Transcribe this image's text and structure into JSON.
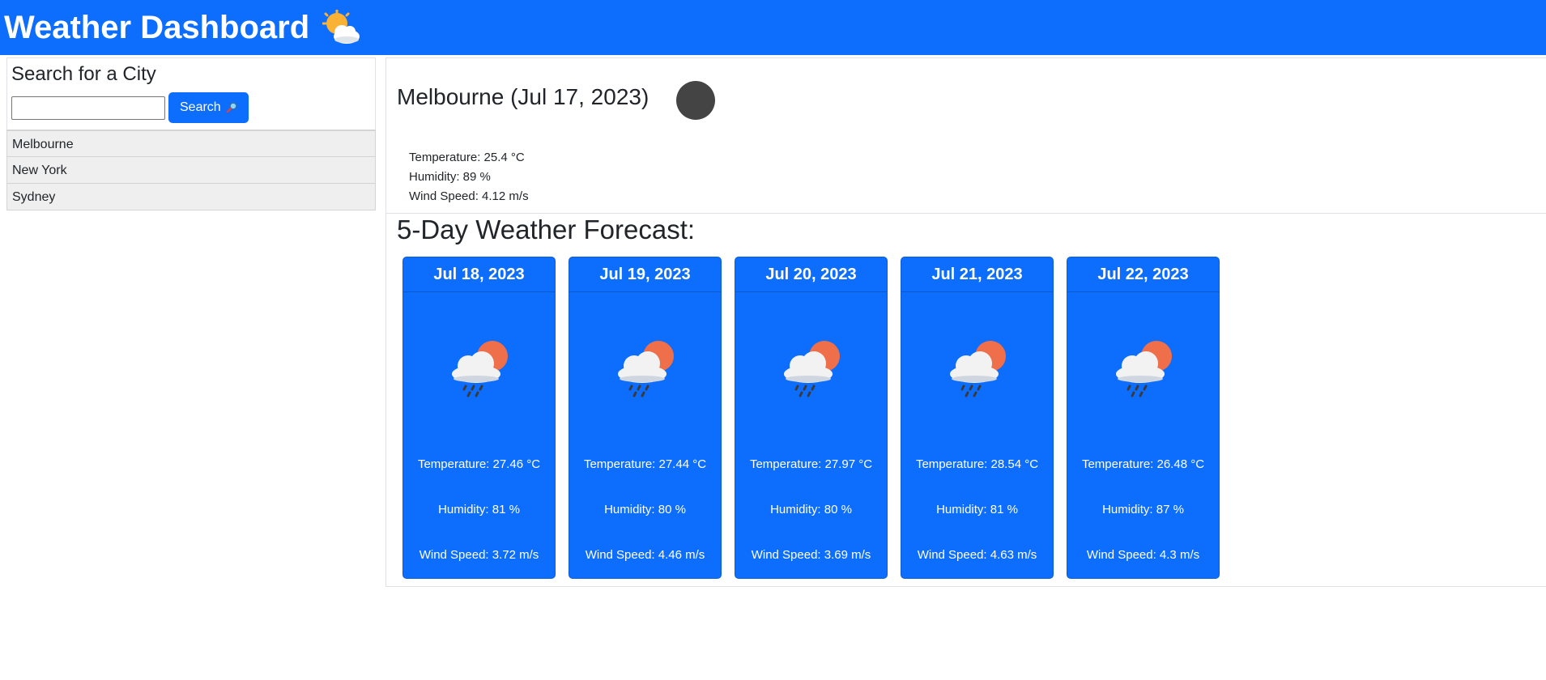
{
  "header": {
    "title": "Weather Dashboard",
    "icon": "sun-behind-cloud-icon"
  },
  "search": {
    "title": "Search for a City",
    "input_value": "",
    "placeholder": "",
    "button_label": "Search",
    "button_icon": "magnifier-icon"
  },
  "history": [
    "Melbourne",
    "New York",
    "Sydney"
  ],
  "current": {
    "title": "Melbourne (Jul 17, 2023)",
    "icon": "weather-icon",
    "temperature": "Temperature: 25.4 °C",
    "humidity": "Humidity: 89 %",
    "wind": "Wind Speed: 4.12 m/s"
  },
  "forecast": {
    "title": "5-Day Weather Forecast:",
    "days": [
      {
        "date": "Jul 18, 2023",
        "icon": "rain-cloud-sun-icon",
        "temperature": "Temperature: 27.46 °C",
        "humidity": "Humidity: 81 %",
        "wind": "Wind Speed: 3.72 m/s"
      },
      {
        "date": "Jul 19, 2023",
        "icon": "rain-cloud-sun-icon",
        "temperature": "Temperature: 27.44 °C",
        "humidity": "Humidity: 80 %",
        "wind": "Wind Speed: 4.46 m/s"
      },
      {
        "date": "Jul 20, 2023",
        "icon": "rain-cloud-sun-icon",
        "temperature": "Temperature: 27.97 °C",
        "humidity": "Humidity: 80 %",
        "wind": "Wind Speed: 3.69 m/s"
      },
      {
        "date": "Jul 21, 2023",
        "icon": "rain-cloud-sun-icon",
        "temperature": "Temperature: 28.54 °C",
        "humidity": "Humidity: 81 %",
        "wind": "Wind Speed: 4.63 m/s"
      },
      {
        "date": "Jul 22, 2023",
        "icon": "rain-cloud-sun-icon",
        "temperature": "Temperature: 26.48 °C",
        "humidity": "Humidity: 87 %",
        "wind": "Wind Speed: 4.3 m/s"
      }
    ]
  },
  "colors": {
    "primary": "#0d6efd",
    "list_bg": "#efefef",
    "current_icon": "#444444",
    "sun": "#ef6f4a"
  }
}
